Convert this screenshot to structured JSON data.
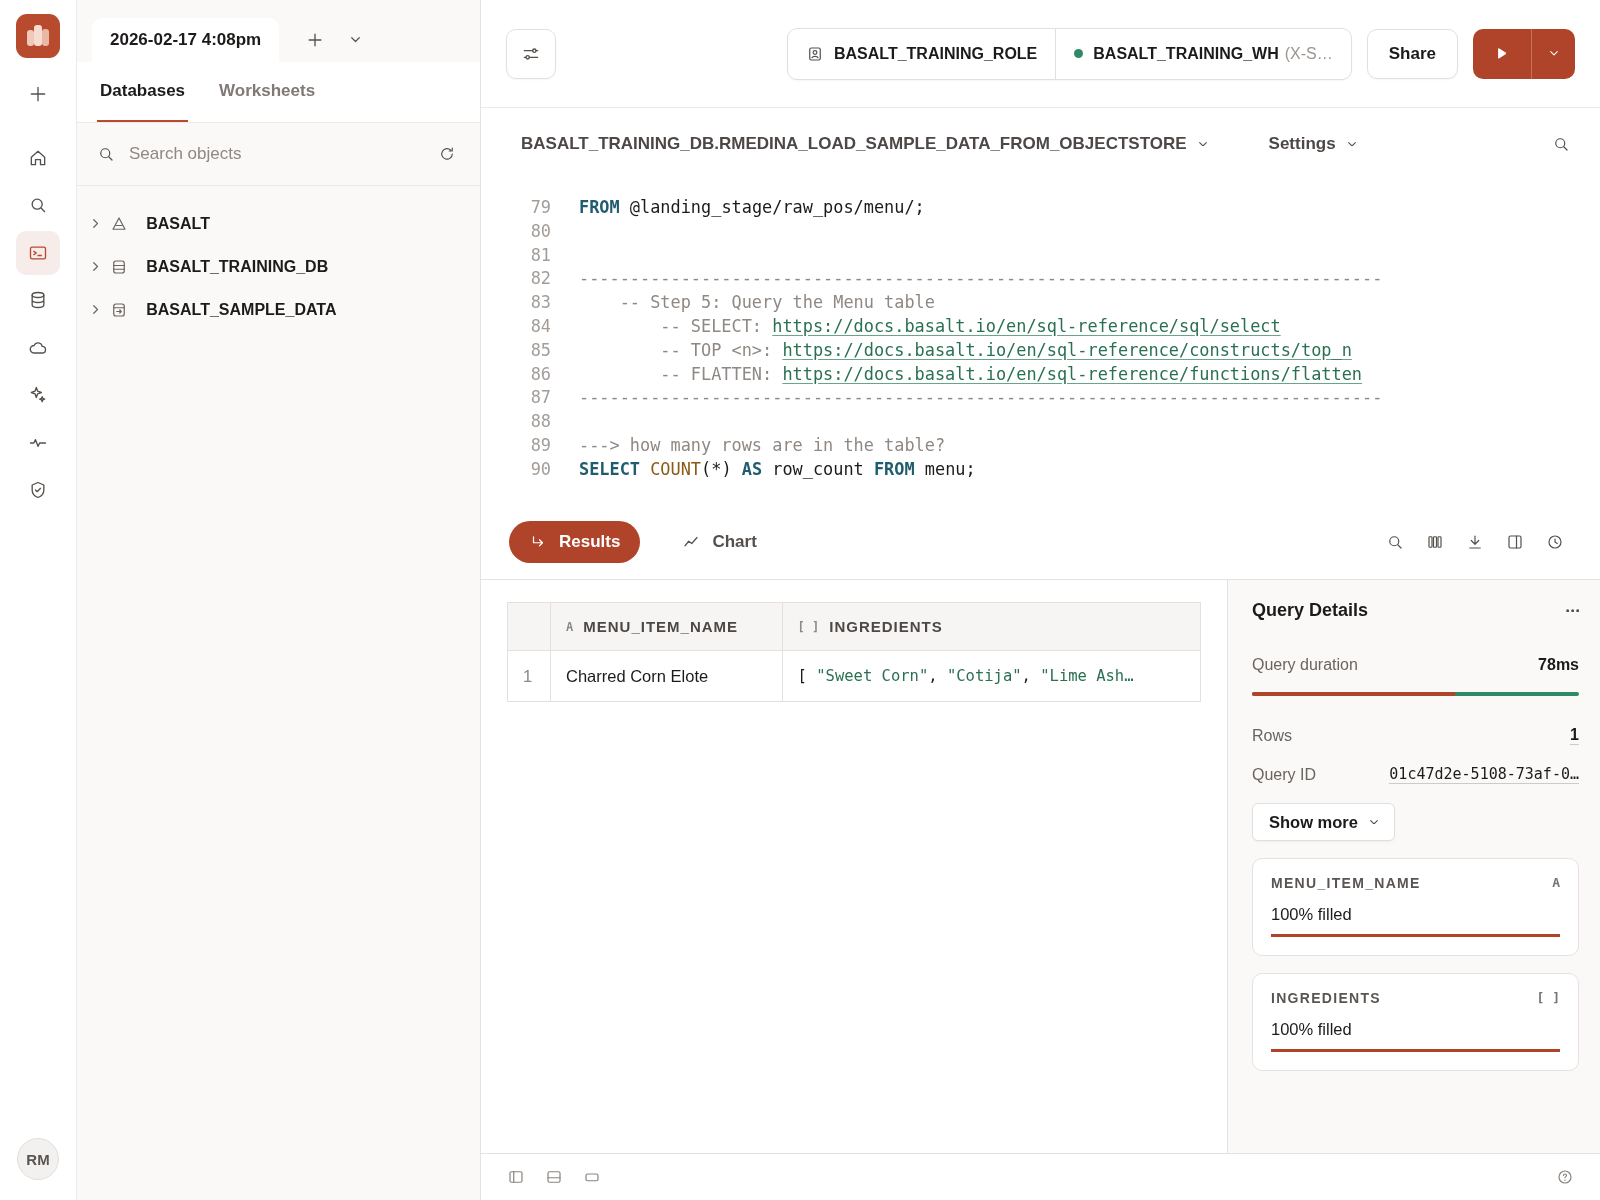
{
  "rail": {
    "avatar": "RM",
    "items": [
      {
        "kind": "new",
        "selected": false
      },
      {
        "kind": "home",
        "selected": false
      },
      {
        "kind": "search",
        "selected": false
      },
      {
        "kind": "worksheet",
        "selected": true
      },
      {
        "kind": "database",
        "selected": false
      },
      {
        "kind": "cloud",
        "selected": false
      },
      {
        "kind": "sparkle",
        "selected": false
      },
      {
        "kind": "activity",
        "selected": false
      },
      {
        "kind": "shield",
        "selected": false
      }
    ]
  },
  "sidebar": {
    "worksheet_tab": "2026-02-17 4:08pm",
    "tabs": [
      {
        "label": "Databases",
        "selected": true
      },
      {
        "label": "Worksheets",
        "selected": false
      }
    ],
    "search": {
      "placeholder": "Search objects"
    },
    "tree": [
      {
        "kind": "account",
        "label": "BASALT",
        "expanded": false
      },
      {
        "kind": "database",
        "label": "BASALT_TRAINING_DB",
        "expanded": false
      },
      {
        "kind": "shared",
        "label": "BASALT_SAMPLE_DATA",
        "expanded": false
      }
    ]
  },
  "toolbar": {
    "role": "BASALT_TRAINING_ROLE",
    "warehouse": "BASALT_TRAINING_WH",
    "warehouse_size": "(X-S…",
    "warehouse_running": true,
    "share": "Share"
  },
  "worksheet": {
    "path": "BASALT_TRAINING_DB.RMEDINA_LOAD_SAMPLE_DATA_FROM_OBJECTSTORE",
    "settings": "Settings"
  },
  "editor": {
    "lines": [
      {
        "number": "79",
        "tokens": [
          {
            "kind": "keyword",
            "text": "FROM"
          },
          {
            "kind": "plain",
            "text": " @landing_stage/raw_pos/menu/;"
          }
        ]
      },
      {
        "number": "80"
      },
      {
        "number": "81"
      },
      {
        "number": "82",
        "tokens": [
          {
            "kind": "comment",
            "text": "-------------------------------------------------------------------------------"
          }
        ]
      },
      {
        "number": "83",
        "tokens": [
          {
            "kind": "comment",
            "text": "    -- Step 5: Query the Menu table"
          }
        ]
      },
      {
        "number": "84",
        "tokens": [
          {
            "kind": "comment",
            "text": "        -- SELECT: "
          },
          {
            "kind": "link",
            "text": "https://docs.basalt.io/en/sql-reference/sql/select"
          }
        ]
      },
      {
        "number": "85",
        "tokens": [
          {
            "kind": "comment",
            "text": "        -- TOP <n>: "
          },
          {
            "kind": "link",
            "text": "https://docs.basalt.io/en/sql-reference/constructs/top_n"
          }
        ]
      },
      {
        "number": "86",
        "tokens": [
          {
            "kind": "comment",
            "text": "        -- FLATTEN: "
          },
          {
            "kind": "link",
            "text": "https://docs.basalt.io/en/sql-reference/functions/flatten"
          }
        ]
      },
      {
        "number": "87",
        "tokens": [
          {
            "kind": "comment",
            "text": "-------------------------------------------------------------------------------"
          }
        ]
      },
      {
        "number": "88"
      },
      {
        "number": "89",
        "tokens": [
          {
            "kind": "comment",
            "text": "---> how many rows are in the table?"
          }
        ]
      },
      {
        "number": "90",
        "tokens": [
          {
            "kind": "keyword",
            "text": "SELECT "
          },
          {
            "kind": "function",
            "text": "COUNT"
          },
          {
            "kind": "plain",
            "text": "(*) "
          },
          {
            "kind": "keyword",
            "text": "AS"
          },
          {
            "kind": "plain",
            "text": " row_count "
          },
          {
            "kind": "keyword",
            "text": "FROM"
          },
          {
            "kind": "plain",
            "text": " menu;"
          }
        ]
      }
    ]
  },
  "result_tabs": [
    {
      "label": "Results",
      "kind": "results",
      "selected": true
    },
    {
      "label": "Chart",
      "kind": "chart",
      "selected": false
    }
  ],
  "table": {
    "columns": [
      {
        "type": "A",
        "name": "MENU_ITEM_NAME"
      },
      {
        "type": "[ ]",
        "name": "INGREDIENTS"
      }
    ],
    "rows": [
      {
        "number": "1",
        "cells": [
          [
            {
              "kind": "plain",
              "text": "Charred Corn Elote"
            }
          ],
          [
            {
              "kind": "plain",
              "text": "[ "
            },
            {
              "kind": "string",
              "text": "\"Sweet Corn\""
            },
            {
              "kind": "plain",
              "text": ", "
            },
            {
              "kind": "string",
              "text": "\"Cotija\""
            },
            {
              "kind": "plain",
              "text": ", "
            },
            {
              "kind": "string",
              "text": "\"Lime Ash…"
            }
          ]
        ]
      }
    ]
  },
  "query_details": {
    "title": "Query Details",
    "duration_label": "Query duration",
    "duration": "78ms",
    "duration_bar": {
      "level": 0.62
    },
    "rows_label": "Rows",
    "rows": "1",
    "id_label": "Query ID",
    "id": "01c47d2e-5108-73af-0…",
    "show_more": "Show more",
    "columns": [
      {
        "name": "MENU_ITEM_NAME",
        "type": "A",
        "filled": "100% filled",
        "level": 1
      },
      {
        "name": "INGREDIENTS",
        "type": "[ ]",
        "filled": "100% filled",
        "level": 1
      }
    ]
  }
}
